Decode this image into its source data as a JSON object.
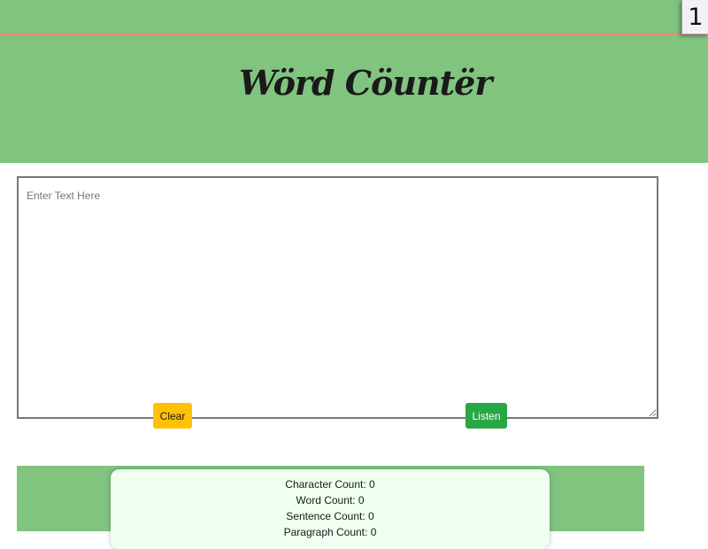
{
  "corner_badge": "1",
  "header": {
    "logo_text": "Wörd Cöuntër"
  },
  "editor": {
    "placeholder": "Enter Text Here",
    "value": ""
  },
  "buttons": {
    "clear_label": "Clear",
    "listen_label": "Listen"
  },
  "stats": {
    "character": "Character Count: 0",
    "word": "Word Count: 0",
    "sentence": "Sentence Count: 0",
    "paragraph": "Paragraph Count: 0"
  },
  "colors": {
    "header_bg": "#80c480",
    "header_line": "#e1907a",
    "clear_button": "#ffc107",
    "listen_button": "#28a745",
    "stats_card": "#effff0"
  }
}
